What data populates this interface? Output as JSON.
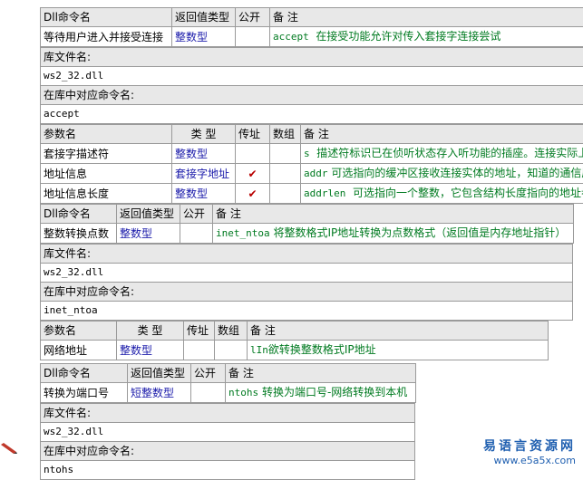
{
  "headers": {
    "dll_cmd": "Dll命令名",
    "ret_type": "返回值类型",
    "public": "公开",
    "remark": "备 注",
    "lib_file": "库文件名:",
    "lib_cmd": "在库中对应命令名:",
    "param": "参数名",
    "type": "类 型",
    "byref": "传址",
    "array": "数组"
  },
  "block1": {
    "name": "等待用户进入并接受连接",
    "ret_type": "整数型",
    "remark_code": "accept",
    "remark_text": "在接受功能允许对传入套接字连接尝试",
    "lib_file": "ws2_32.dll",
    "lib_cmd": "accept",
    "params": [
      {
        "name": "套接字描述符",
        "type": "整数型",
        "byref": "",
        "code": "s",
        "desc": "描述符标识已在侦听状态存入听功能的插座。连接实际上是建立在返回的套接字接受"
      },
      {
        "name": "地址信息",
        "type": "套接字地址",
        "byref": "✔",
        "code": "addr",
        "desc": "可选指向的缓冲区接收连接实体的地址，知道的通信层"
      },
      {
        "name": "地址信息长度",
        "type": "整数型",
        "byref": "✔",
        "code": "addrlen",
        "desc": "可选指向一个整数，它包含结构长度指向的地址参数"
      }
    ]
  },
  "block2": {
    "name": "整数转换点数",
    "ret_type": "整数型",
    "remark_code": "inet_ntoa",
    "remark_text": "将整数格式IP地址转换为点数格式（返回值是内存地址指针）",
    "lib_file": "ws2_32.dll",
    "lib_cmd": "inet_ntoa",
    "params": [
      {
        "name": "网络地址",
        "type": "整数型",
        "byref": "",
        "code": "lIn",
        "desc": "欲转换整数格式IP地址"
      }
    ]
  },
  "block3": {
    "name": "转换为端口号",
    "ret_type": "短整数型",
    "remark_code": "ntohs",
    "remark_text": "转换为端口号-网络转换到本机",
    "lib_file": "ws2_32.dll",
    "lib_cmd": "ntohs"
  },
  "watermark": {
    "cn": "易语言资源网",
    "url": "www.e5a5x.com"
  },
  "colors": {
    "header_bg": "#e8e8e8",
    "border": "#9a9a9a",
    "type_text": "#1a1aaa",
    "remark_text": "#007a20",
    "check": "#b80000",
    "watermark": "#1f5fb0"
  }
}
